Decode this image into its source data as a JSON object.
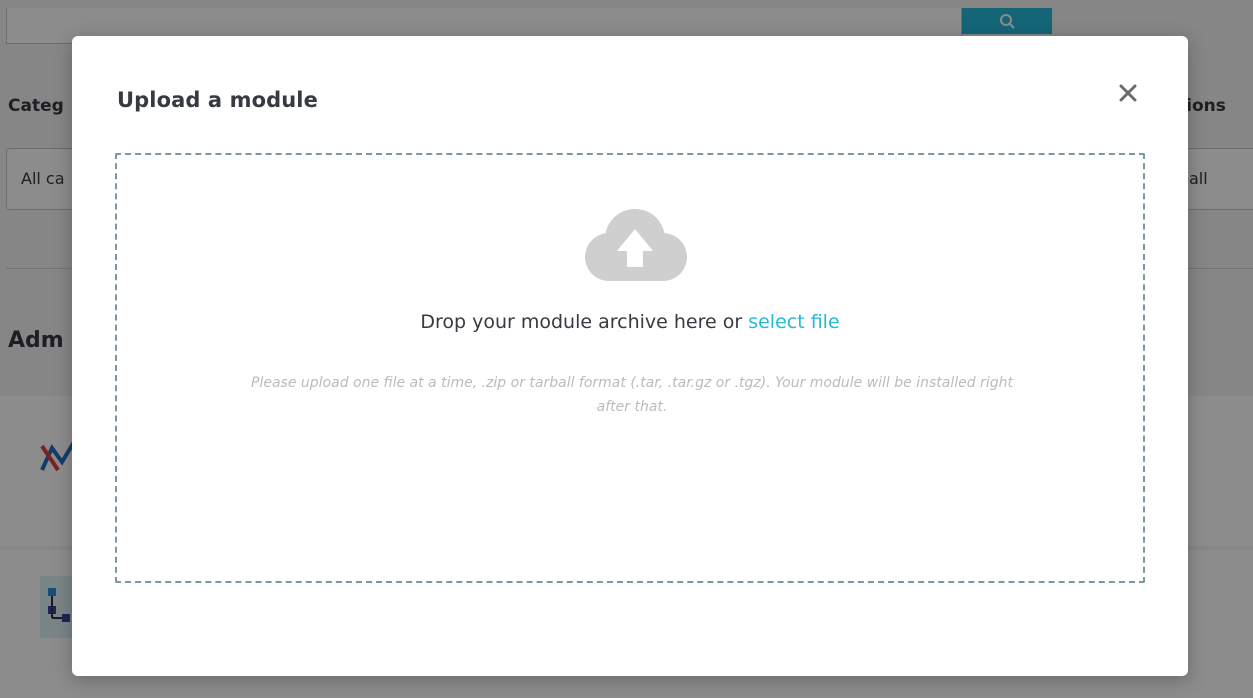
{
  "background": {
    "category_label": "Categ",
    "category_value": "All ca",
    "actions_label": "tions",
    "actions_value": "all",
    "section_title": "Adm"
  },
  "modal": {
    "title": "Upload a module",
    "close_icon": "close-icon",
    "dropzone": {
      "icon": "cloud-upload-icon",
      "drop_text": "Drop your module archive here or ",
      "select_file_link": "select file",
      "hint_line_1": "Please upload one file at a time, .zip or tarball format (.tar, .tar.gz or .tgz). Your module will be installed right",
      "hint_line_2": "after that."
    }
  },
  "colors": {
    "accent": "#25b9d7",
    "text": "#363a41",
    "hint": "#bbbbbb",
    "dashed_border": "#7e96a1",
    "icon_gray": "#cfcfcf"
  }
}
